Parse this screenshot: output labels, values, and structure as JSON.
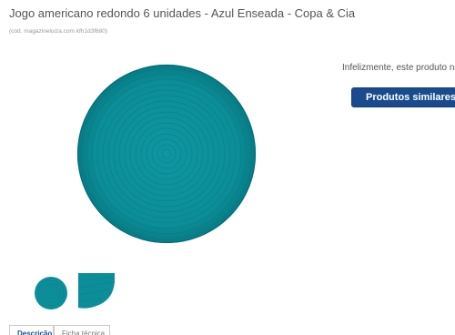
{
  "product": {
    "title": "Jogo americano redondo 6 unidades - Azul Enseada - Copa & Cia",
    "code": "(cód. magazineluiza.com kfh1d3f680)"
  },
  "status": {
    "unavailable_text": "Infelizmente, este produto não",
    "similar_button_label": "Produtos similares"
  },
  "tabs": [
    "Descrição",
    "Ficha técnica"
  ],
  "colors": {
    "mat": "#0c8e98",
    "mat_dark": "#067a84",
    "button": "#1a4b8f"
  },
  "icons": {
    "main_image": "round-placemat-image",
    "thumbnail_1": "round-placemat-thumbnail",
    "thumbnail_2": "placemat-closeup-thumbnail"
  }
}
